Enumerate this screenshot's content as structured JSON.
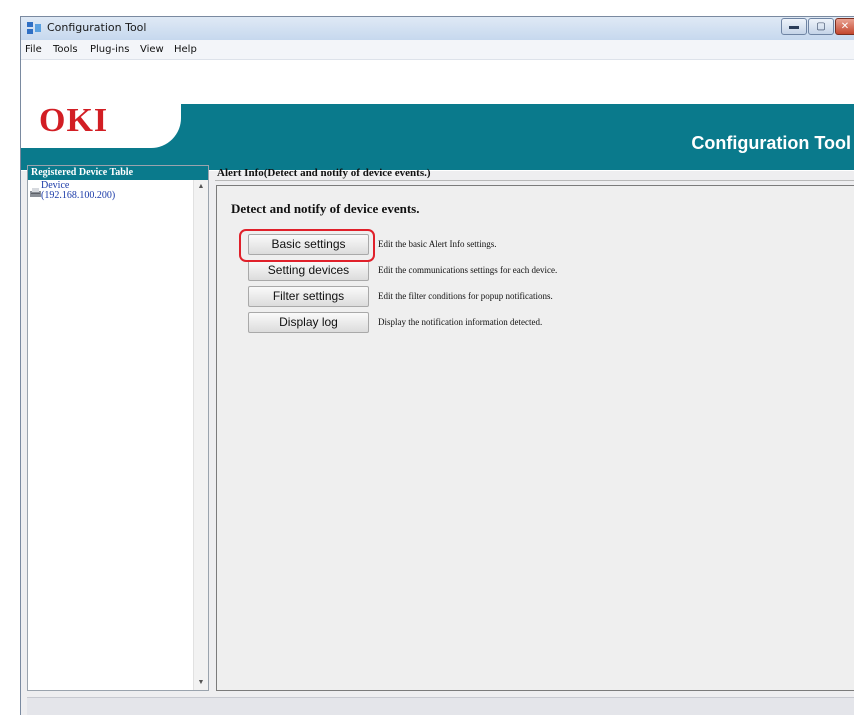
{
  "window": {
    "title": "Configuration Tool"
  },
  "menu": [
    "File",
    "Tools",
    "Plug-ins",
    "View",
    "Help"
  ],
  "banner": {
    "logo": "OKI",
    "title": "Configuration Tool"
  },
  "sidebar": {
    "header": "Registered Device Table",
    "device": {
      "name": "Device",
      "ip": "(192.168.100.200)"
    }
  },
  "main": {
    "section_title": "Alert Info(Detect and notify of device events.)",
    "heading": "Detect and notify of device events.",
    "actions": [
      {
        "label": "Basic settings",
        "description": "Edit the basic Alert Info settings.",
        "highlighted": true
      },
      {
        "label": "Setting devices",
        "description": "Edit the communications settings for each device.",
        "highlighted": false
      },
      {
        "label": "Filter settings",
        "description": "Edit the filter conditions for popup notifications.",
        "highlighted": false
      },
      {
        "label": "Display log",
        "description": "Display the notification information detected.",
        "highlighted": false
      }
    ]
  },
  "colors": {
    "brand_teal": "#0a7a8c",
    "logo_red": "#d21e24",
    "highlight_red": "#e0202a",
    "device_link_blue": "#1a3aa8"
  },
  "icons": {
    "app": "configuration-tool-icon",
    "device": "printer-icon",
    "minimize": "minimize-icon",
    "maximize": "maximize-icon",
    "close": "close-icon"
  }
}
